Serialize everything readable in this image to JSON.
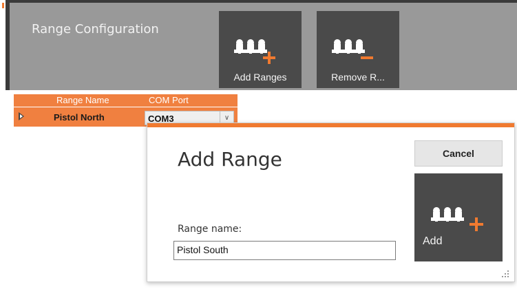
{
  "ribbon": {
    "title": "Range Configuration",
    "tiles": [
      {
        "label": "Add Ranges",
        "icon": "add-ranges-icon"
      },
      {
        "label": "Remove R...",
        "icon": "remove-ranges-icon"
      }
    ]
  },
  "grid": {
    "columns": [
      "Range Name",
      "COM Port"
    ],
    "rows": [
      {
        "name": "Pistol North",
        "port": "COM3"
      }
    ]
  },
  "dialog": {
    "title": "Add Range",
    "name_label": "Range name:",
    "name_value": "Pistol South",
    "cancel_label": "Cancel",
    "add_label": "Add"
  },
  "colors": {
    "accent": "#f07a30",
    "ribbon": "#999999",
    "tile": "#4a4a4a"
  }
}
